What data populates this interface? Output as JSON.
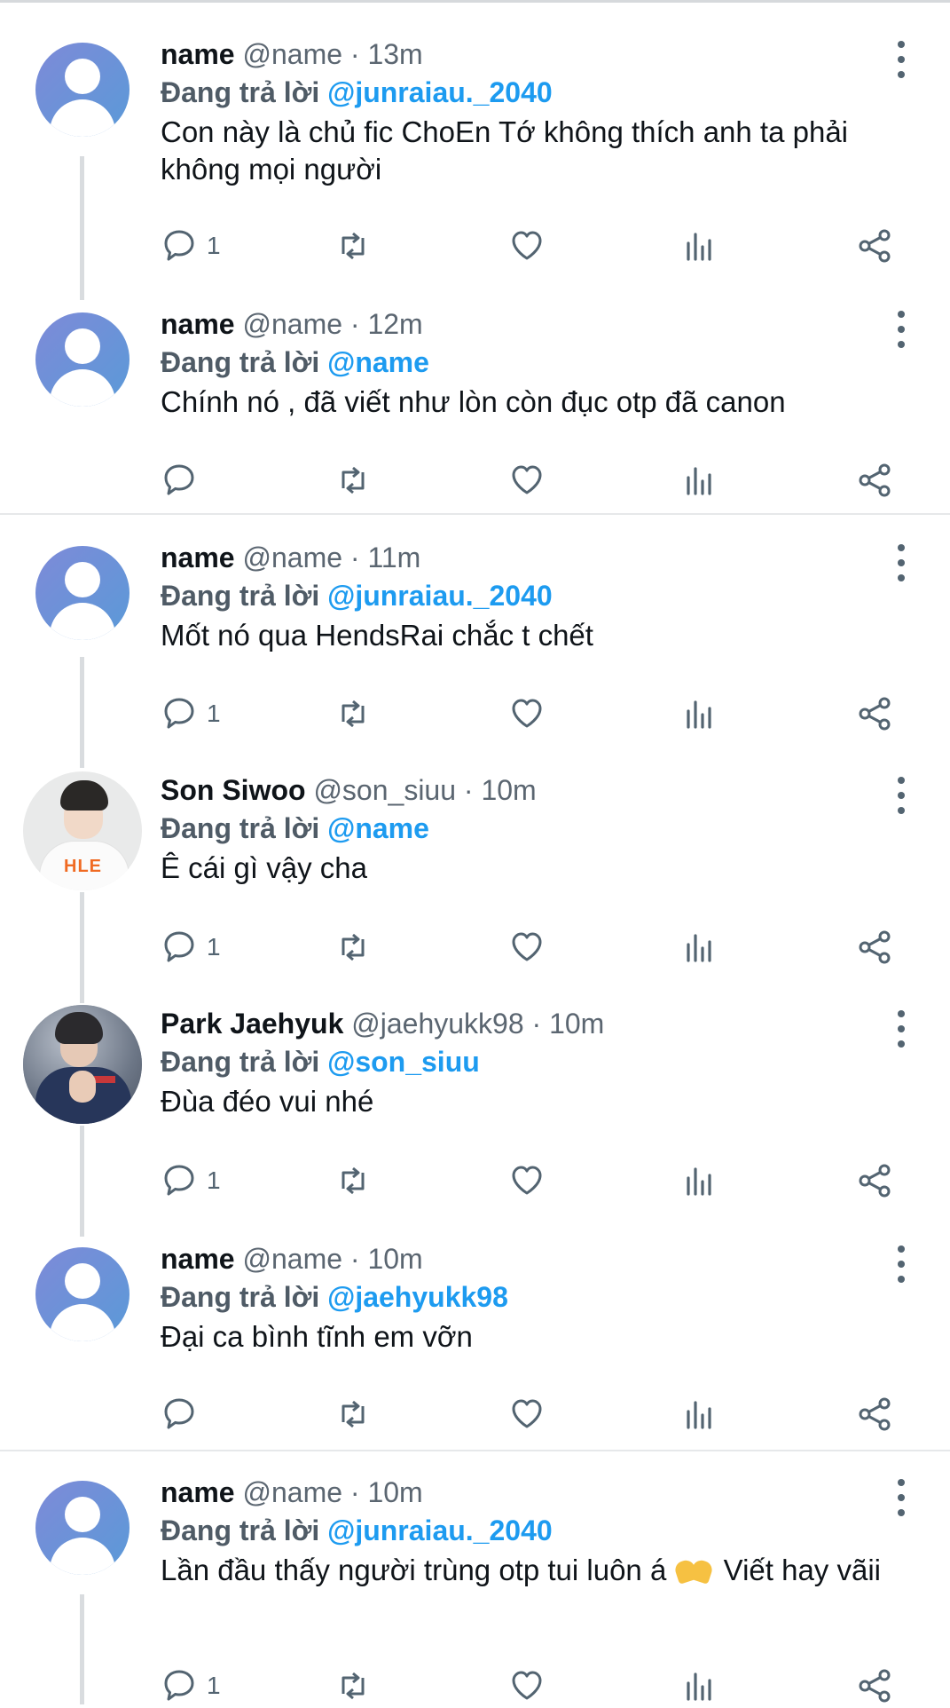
{
  "reply_prefix": "Đang trả lời",
  "tweets": [
    {
      "name": "name",
      "handle": "@name",
      "time": "13m",
      "reply_to": "@junraiau._2040",
      "text": "Con này là chủ fic ChoEn Tớ không thích anh ta phải không mọi người",
      "reply_count": "1"
    },
    {
      "name": "name",
      "handle": "@name",
      "time": "12m",
      "reply_to": "@name",
      "text": "Chính nó , đã viết như lòn còn đục otp đã canon",
      "reply_count": ""
    },
    {
      "name": "name",
      "handle": "@name",
      "time": "11m",
      "reply_to": "@junraiau._2040",
      "text": "Mốt nó qua HendsRai chắc t chết",
      "reply_count": "1"
    },
    {
      "name": "Son Siwoo",
      "handle": "@son_siuu",
      "time": "10m",
      "reply_to": "@name",
      "text": "Ê cái gì vậy cha",
      "reply_count": "1"
    },
    {
      "name": "Park Jaehyuk",
      "handle": "@jaehyukk98",
      "time": "10m",
      "reply_to": "@son_siuu",
      "text": "Đùa đéo vui nhé",
      "reply_count": "1"
    },
    {
      "name": "name",
      "handle": "@name",
      "time": "10m",
      "reply_to": "@jaehyukk98",
      "text": "Đại ca bình tĩnh em vỡn",
      "reply_count": ""
    },
    {
      "name": "name",
      "handle": "@name",
      "time": "10m",
      "reply_to": "@junraiau._2040",
      "text_before": "Lần đầu thấy người trùng otp tui luôn á",
      "emoji": "heart-hands-emoji",
      "text_after": "Viết hay vãii",
      "reply_count": "1"
    }
  ],
  "icons": [
    "reply-icon",
    "retweet-icon",
    "like-icon",
    "views-icon",
    "share-icon",
    "more-icon"
  ],
  "colors": {
    "mention": "#1d9bf0",
    "icon": "#536471",
    "avatar": "#6f8fd8"
  }
}
